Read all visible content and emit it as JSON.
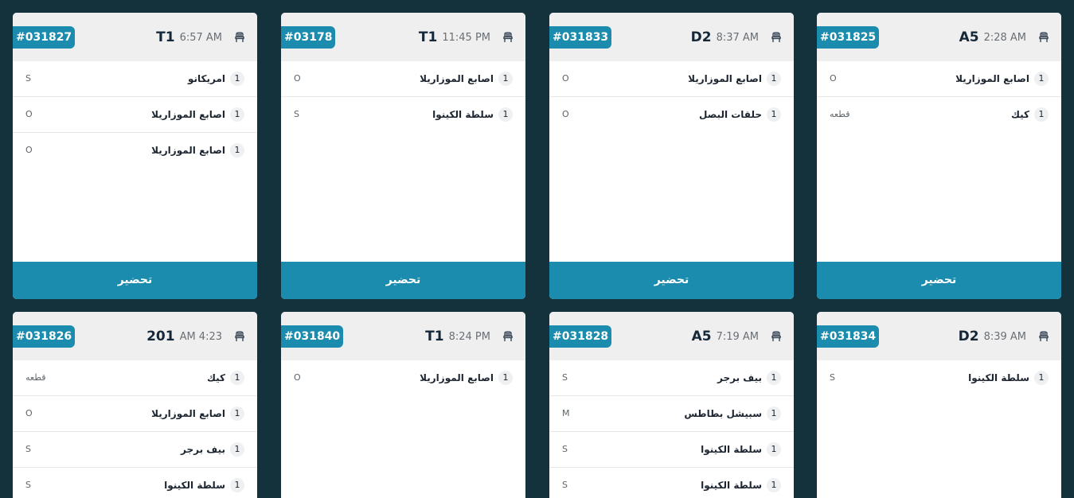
{
  "accent_color": "#1b8cad",
  "background_color": "#14323b",
  "prepare_label": "تحضير",
  "seat_icon": "armchair-icon",
  "orders": [
    {
      "number": "#031827",
      "table": "T1",
      "time": "6:57 AM",
      "items": [
        {
          "qty": "1",
          "name": "امريكانو",
          "size": "S"
        },
        {
          "qty": "1",
          "name": "اصابع الموزاريلا",
          "size": "O"
        },
        {
          "qty": "1",
          "name": "اصابع الموزاريلا",
          "size": "O"
        }
      ]
    },
    {
      "number": "#03178",
      "table": "T1",
      "time": "11:45 PM",
      "items": [
        {
          "qty": "1",
          "name": "اصابع الموزاريلا",
          "size": "O"
        },
        {
          "qty": "1",
          "name": "سلطة الكينوا",
          "size": "S"
        }
      ]
    },
    {
      "number": "#031833",
      "table": "D2",
      "time": "8:37 AM",
      "items": [
        {
          "qty": "1",
          "name": "اصابع الموزاريلا",
          "size": "O"
        },
        {
          "qty": "1",
          "name": "حلقات البصل",
          "size": "O"
        }
      ]
    },
    {
      "number": "#031825",
      "table": "A5",
      "time": "2:28 AM",
      "items": [
        {
          "qty": "1",
          "name": "اصابع الموزاريلا",
          "size": "O"
        },
        {
          "qty": "1",
          "name": "كيك",
          "size": "قطعه"
        }
      ]
    },
    {
      "number": "#031826",
      "table": "201",
      "time": "AM 4:23",
      "items": [
        {
          "qty": "1",
          "name": "كيك",
          "size": "قطعه"
        },
        {
          "qty": "1",
          "name": "اصابع الموزاريلا",
          "size": "O"
        },
        {
          "qty": "1",
          "name": "بيف برجر",
          "size": "S"
        },
        {
          "qty": "1",
          "name": "سلطة الكينوا",
          "size": "S"
        }
      ]
    },
    {
      "number": "#031840",
      "table": "T1",
      "time": "8:24 PM",
      "items": [
        {
          "qty": "1",
          "name": "اصابع الموزاريلا",
          "size": "O"
        }
      ]
    },
    {
      "number": "#031828",
      "table": "A5",
      "time": "7:19 AM",
      "items": [
        {
          "qty": "1",
          "name": "بيف برجر",
          "size": "S"
        },
        {
          "qty": "1",
          "name": "سبيشل بطاطس",
          "size": "M"
        },
        {
          "qty": "1",
          "name": "سلطة الكينوا",
          "size": "S"
        },
        {
          "qty": "1",
          "name": "سلطة الكينوا",
          "size": "S"
        }
      ]
    },
    {
      "number": "#031834",
      "table": "D2",
      "time": "8:39 AM",
      "items": [
        {
          "qty": "1",
          "name": "سلطة الكينوا",
          "size": "S"
        }
      ]
    }
  ]
}
